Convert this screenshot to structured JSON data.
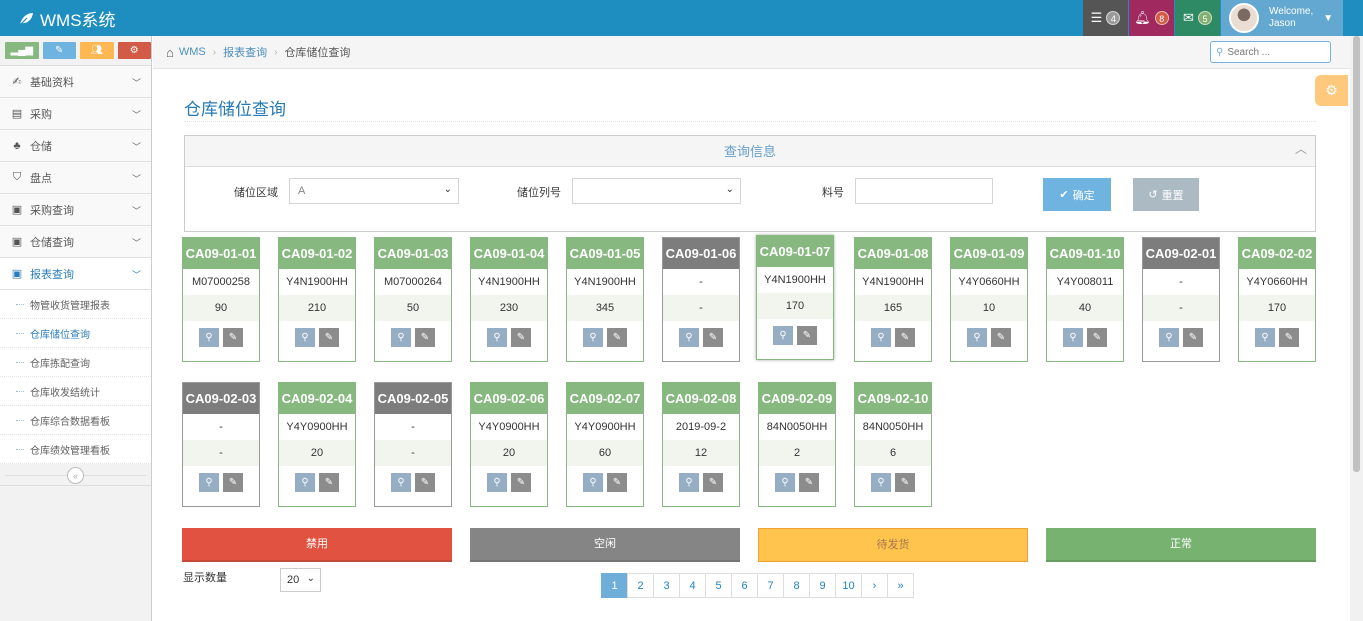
{
  "brand": {
    "title": "WMS系统"
  },
  "navbar": {
    "badges": [
      {
        "icon": "tasks-icon",
        "count": "4",
        "bg": "#555555",
        "badge_bg": "#9a9a9a"
      },
      {
        "icon": "bell-icon",
        "count": "8",
        "bg": "#a0295f",
        "badge_bg": "#d15b47"
      },
      {
        "icon": "envelope-icon",
        "count": "5",
        "bg": "#2e8965",
        "badge_bg": "#82af6f"
      }
    ],
    "user": {
      "welcome": "Welcome,",
      "name": "Jason"
    }
  },
  "sidebar": {
    "shortcut_colors": [
      "#87b87f",
      "#6fb3e0",
      "#ffb752",
      "#d15b47"
    ],
    "menu": [
      {
        "label": "基础资料",
        "icon": "user-edit-icon"
      },
      {
        "label": "采购",
        "icon": "file-icon"
      },
      {
        "label": "仓储",
        "icon": "cubes-icon"
      },
      {
        "label": "盘点",
        "icon": "shield-icon"
      },
      {
        "label": "采购查询",
        "icon": "report-icon"
      },
      {
        "label": "仓储查询",
        "icon": "report-icon"
      },
      {
        "label": "报表查询",
        "icon": "report-icon"
      }
    ],
    "submenu": [
      "物管收货管理报表",
      "仓库储位查询",
      "仓库拣配查询",
      "仓库收发结统计",
      "仓库综合数据看板",
      "仓库绩效管理看板"
    ]
  },
  "breadcrumb": {
    "home": "WMS",
    "parent": "报表查询",
    "current": "仓库储位查询"
  },
  "search": {
    "placeholder": "Search ..."
  },
  "page": {
    "title": "仓库储位查询"
  },
  "query": {
    "header": "查询信息",
    "area_label": "储位区域",
    "area_value": "A",
    "column_label": "储位列号",
    "column_value": "",
    "part_label": "料号",
    "part_value": "",
    "confirm": "确定",
    "reset": "重置"
  },
  "locations": [
    {
      "code": "CA09-01-01",
      "part": "M07000258",
      "qty": "90",
      "status": "normal"
    },
    {
      "code": "CA09-01-02",
      "part": "Y4N1900HH",
      "qty": "210",
      "status": "normal"
    },
    {
      "code": "CA09-01-03",
      "part": "M07000264",
      "qty": "50",
      "status": "normal"
    },
    {
      "code": "CA09-01-04",
      "part": "Y4N1900HH",
      "qty": "230",
      "status": "normal"
    },
    {
      "code": "CA09-01-05",
      "part": "Y4N1900HH",
      "qty": "345",
      "status": "normal"
    },
    {
      "code": "CA09-01-06",
      "part": "-",
      "qty": "-",
      "status": "idle"
    },
    {
      "code": "CA09-01-07",
      "part": "Y4N1900HH",
      "qty": "170",
      "status": "normal",
      "selected": true
    },
    {
      "code": "CA09-01-08",
      "part": "Y4N1900HH",
      "qty": "165",
      "status": "normal"
    },
    {
      "code": "CA09-01-09",
      "part": "Y4Y0660HH",
      "qty": "10",
      "status": "normal"
    },
    {
      "code": "CA09-01-10",
      "part": "Y4Y008011",
      "qty": "40",
      "status": "normal"
    },
    {
      "code": "CA09-02-01",
      "part": "-",
      "qty": "-",
      "status": "idle"
    },
    {
      "code": "CA09-02-02",
      "part": "Y4Y0660HH",
      "qty": "170",
      "status": "normal"
    },
    {
      "code": "CA09-02-03",
      "part": "-",
      "qty": "-",
      "status": "idle"
    },
    {
      "code": "CA09-02-04",
      "part": "Y4Y0900HH",
      "qty": "20",
      "status": "normal"
    },
    {
      "code": "CA09-02-05",
      "part": "-",
      "qty": "-",
      "status": "idle"
    },
    {
      "code": "CA09-02-06",
      "part": "Y4Y0900HH",
      "qty": "20",
      "status": "normal"
    },
    {
      "code": "CA09-02-07",
      "part": "Y4Y0900HH",
      "qty": "60",
      "status": "normal"
    },
    {
      "code": "CA09-02-08",
      "part": "2019-09-2",
      "qty": "12",
      "status": "normal"
    },
    {
      "code": "CA09-02-09",
      "part": "84N0050HH",
      "qty": "2",
      "status": "normal"
    },
    {
      "code": "CA09-02-10",
      "part": "84N0050HH",
      "qty": "6",
      "status": "normal"
    }
  ],
  "legend": {
    "disabled": "禁用",
    "idle": "空闲",
    "pending": "待发货",
    "normal": "正常"
  },
  "footer": {
    "show_label": "显示数量",
    "page_size": "20",
    "pages": [
      "1",
      "2",
      "3",
      "4",
      "5",
      "6",
      "7",
      "8",
      "9",
      "10",
      "›",
      "»"
    ],
    "current_page": "1"
  }
}
